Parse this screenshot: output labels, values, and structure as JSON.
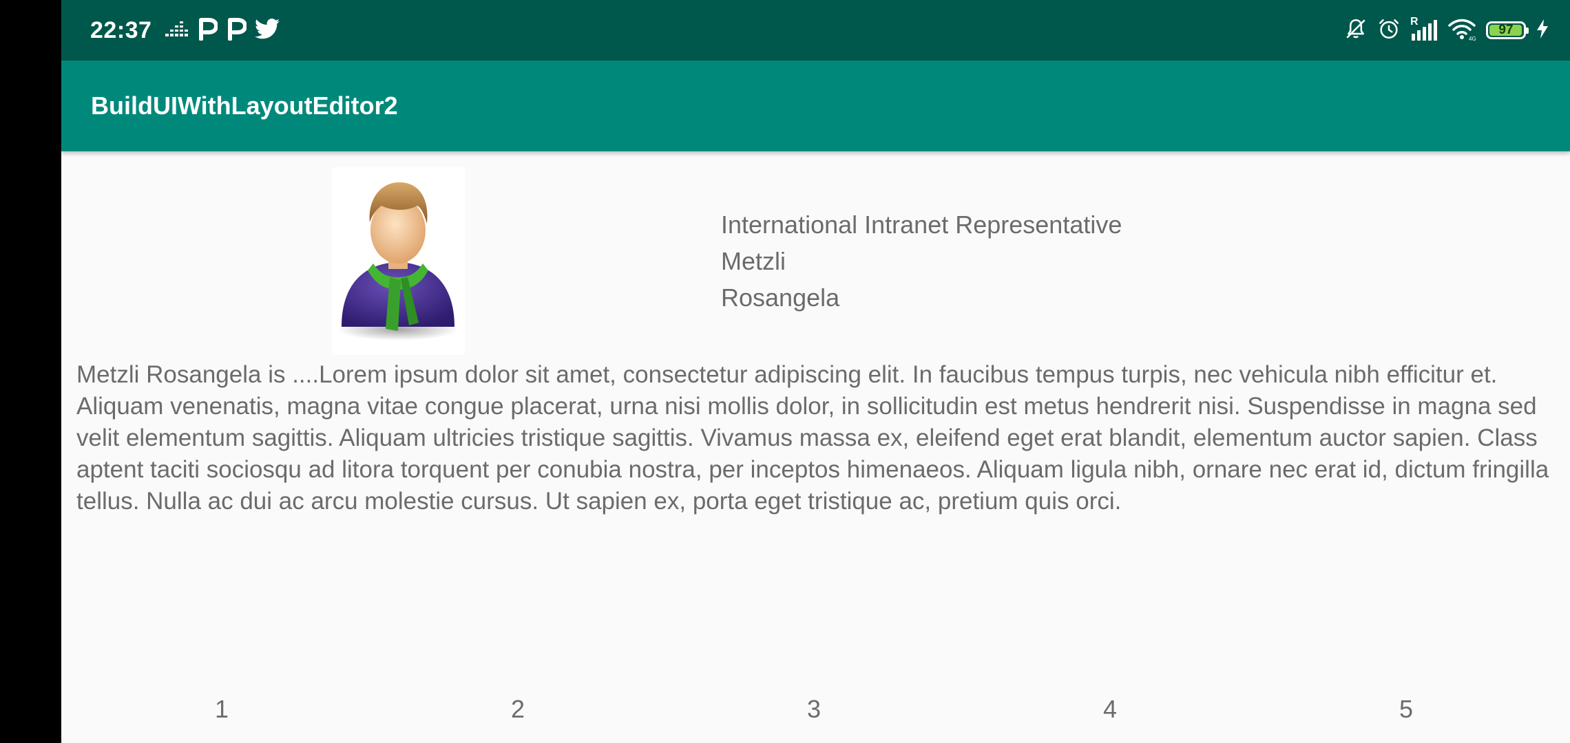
{
  "status_bar": {
    "time": "22:37",
    "notification_icons": [
      "equalizer-icon",
      "p-app-icon",
      "p-app-icon",
      "twitter-icon"
    ],
    "system_icons": [
      "bell-off-icon",
      "alarm-icon",
      "signal-icon",
      "wifi-icon",
      "battery-icon",
      "charging-icon"
    ],
    "signal_label": "R",
    "battery_level": "97",
    "battery_fraction": 0.97
  },
  "app_bar": {
    "title": "BuildUIWithLayoutEditor2"
  },
  "profile": {
    "job_title": "International Intranet Representative",
    "first_name": "Metzli",
    "last_name": "Rosangela",
    "description": "Metzli Rosangela is ....Lorem ipsum dolor sit amet, consectetur adipiscing elit. In faucibus tempus turpis, nec vehicula nibh efficitur et. Aliquam venenatis, magna vitae congue placerat, urna nisi mollis dolor, in sollicitudin est metus hendrerit nisi. Suspendisse in magna sed velit elementum sagittis. Aliquam ultricies tristique sagittis. Vivamus massa ex, eleifend eget erat blandit, elementum auctor sapien. Class aptent taciti sociosqu ad litora torquent per conubia nostra, per inceptos himenaeos. Aliquam ligula nibh, ornare nec erat id, dictum fringilla tellus. Nulla ac dui ac arcu molestie cursus. Ut sapien ex, porta eget tristique ac, pretium quis orci."
  },
  "bottom_numbers": [
    "1",
    "2",
    "3",
    "4",
    "5"
  ],
  "colors": {
    "status_bar": "#00574b",
    "app_bar": "#00897b",
    "background": "#fafafa",
    "text": "#6b6b6b"
  }
}
